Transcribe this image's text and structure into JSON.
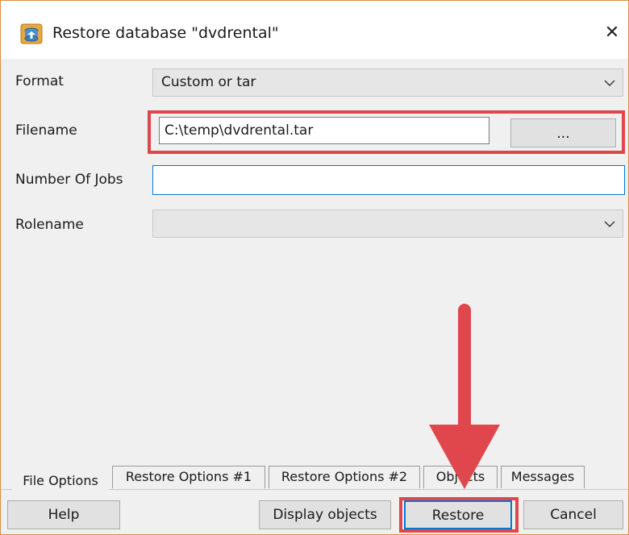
{
  "window": {
    "title": "Restore database \"dvdrental\"",
    "close_glyph": "✕"
  },
  "form": {
    "format": {
      "label": "Format",
      "value": "Custom or tar"
    },
    "filename": {
      "label": "Filename",
      "value": "C:\\temp\\dvdrental.tar",
      "browse_label": "..."
    },
    "jobs": {
      "label": "Number Of Jobs",
      "value": ""
    },
    "rolename": {
      "label": "Rolename",
      "value": ""
    }
  },
  "tabs": [
    {
      "label": "File Options",
      "active": true
    },
    {
      "label": "Restore Options #1",
      "active": false
    },
    {
      "label": "Restore Options #2",
      "active": false
    },
    {
      "label": "Objects",
      "active": false
    },
    {
      "label": "Messages",
      "active": false
    }
  ],
  "buttons": {
    "help": "Help",
    "display_objects": "Display objects",
    "restore": "Restore",
    "cancel": "Cancel"
  },
  "icons": {
    "app": "database-restore-icon",
    "dropdown": "chevron-down-icon",
    "close": "close-icon"
  },
  "colors": {
    "highlight": "#e0474c",
    "focus": "#0078d7",
    "window_border": "#d98e4a"
  }
}
